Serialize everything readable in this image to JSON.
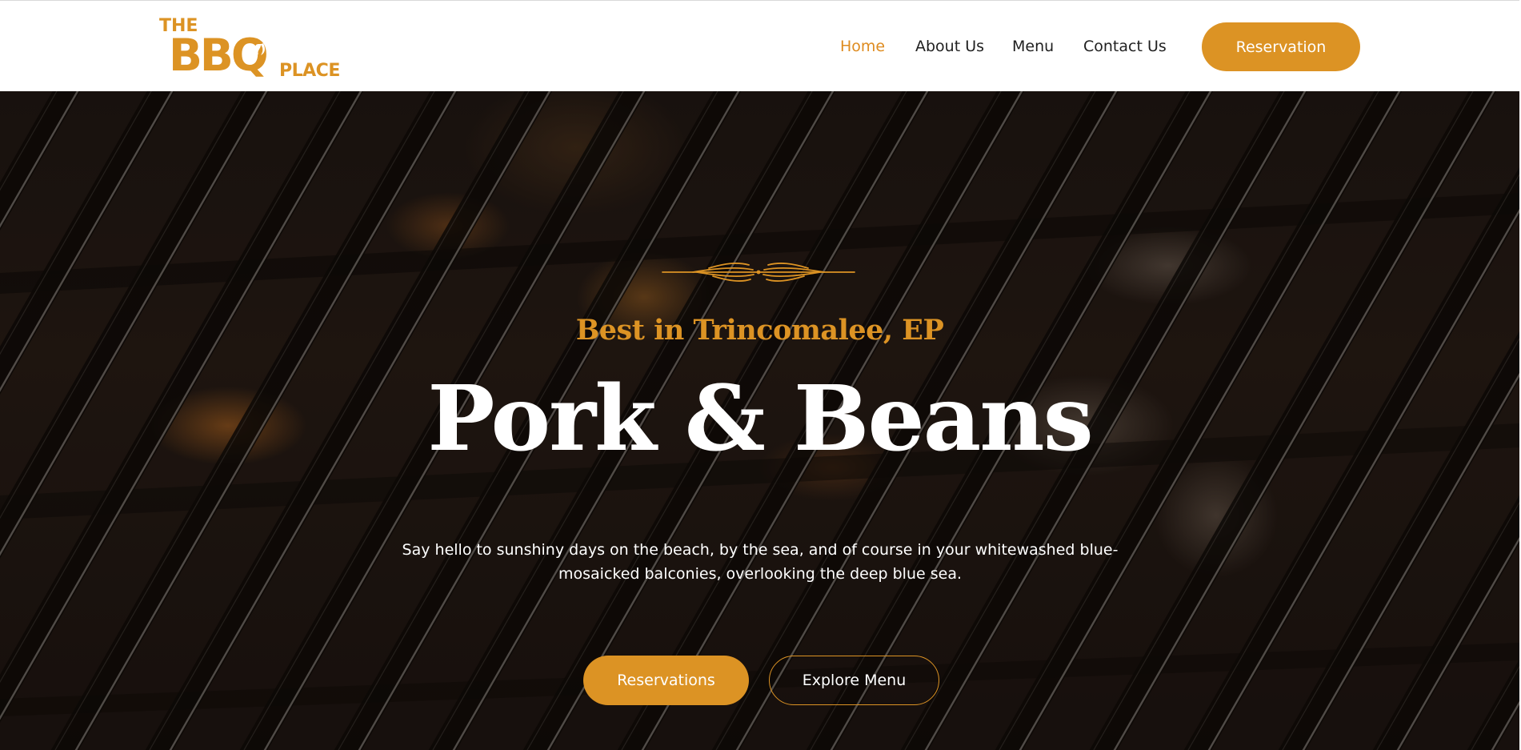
{
  "header": {
    "logo": {
      "line1": "THE",
      "line2": "BBQ",
      "line3": "PLACE"
    },
    "nav": [
      {
        "label": "Home",
        "active": true
      },
      {
        "label": "About Us",
        "active": false
      },
      {
        "label": "Menu",
        "active": false
      },
      {
        "label": "Contact Us",
        "active": false
      }
    ],
    "cta_label": "Reservation"
  },
  "hero": {
    "ornament_icon": "wheat-divider-icon",
    "tagline": "Best in Trincomalee, EP",
    "title": "Pork & Beans",
    "description": "Say hello to sunshiny days on the beach, by the sea, and of course in your whitewashed blue-mosaicked balconies, overlooking the deep blue sea.",
    "primary_button": "Reservations",
    "secondary_button": "Explore Menu"
  },
  "colors": {
    "accent": "#dc9324",
    "nav_active": "#de8b1f",
    "nav_text": "#1f1f1f",
    "hero_text": "#ffffff"
  }
}
